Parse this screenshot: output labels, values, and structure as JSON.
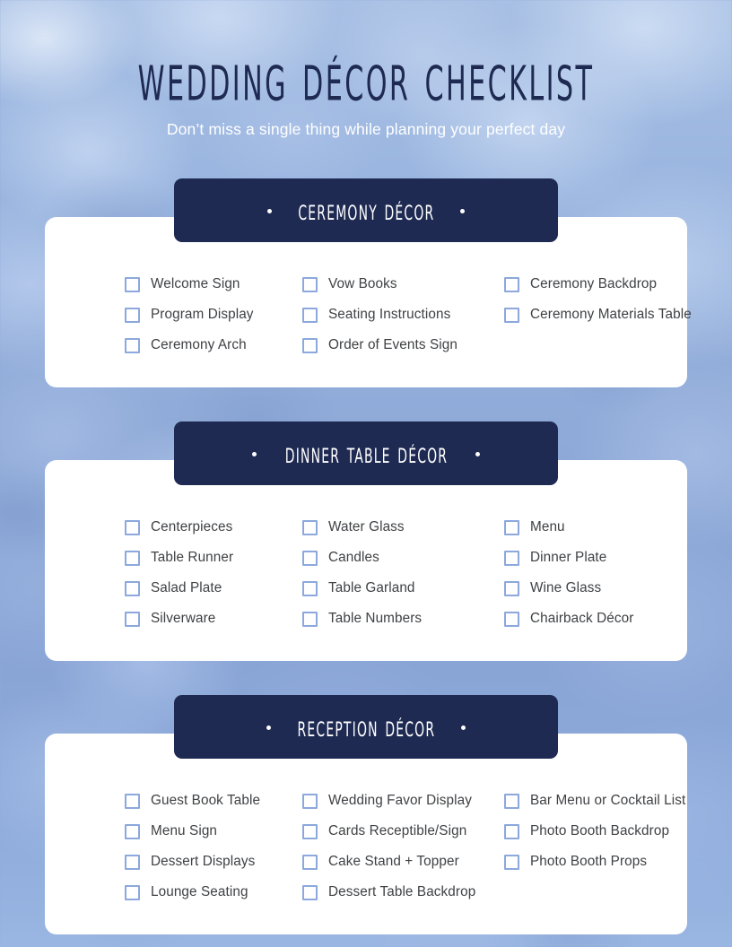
{
  "header": {
    "title": "Wedding Décor Checklist",
    "subtitle": "Don’t miss a single thing while planning your perfect day"
  },
  "colors": {
    "navy": "#1E2A52",
    "title_navy": "#1F2A52",
    "checkbox_border": "#8CA8DC",
    "label_text": "#3F4144",
    "card_bg": "#FFFFFF",
    "background_blue": "#8FAAD8"
  },
  "badge_dot": "•",
  "sections": [
    {
      "id": "ceremony",
      "title": "Ceremony Décor",
      "columns": [
        [
          "Welcome Sign",
          "Program Display",
          "Ceremony Arch"
        ],
        [
          "Vow Books",
          "Seating Instructions",
          "Order of Events Sign"
        ],
        [
          "Ceremony Backdrop",
          "Ceremony Materials Table",
          ""
        ]
      ]
    },
    {
      "id": "dinner",
      "title": "Dinner Table Décor",
      "columns": [
        [
          "Centerpieces",
          "Table Runner",
          "Salad Plate",
          "Silverware"
        ],
        [
          "Water Glass",
          "Candles",
          "Table Garland",
          "Table Numbers"
        ],
        [
          "Menu",
          "Dinner Plate",
          "Wine Glass",
          "Chairback Décor"
        ]
      ]
    },
    {
      "id": "reception",
      "title": "Reception Décor",
      "columns": [
        [
          "Guest Book Table",
          "Menu Sign",
          "Dessert Displays",
          "Lounge Seating"
        ],
        [
          "Wedding Favor Display",
          "Cards Receptible/Sign",
          "Cake Stand + Topper",
          "Dessert Table Backdrop"
        ],
        [
          "Bar Menu or Cocktail List",
          "Photo Booth Backdrop",
          "Photo Booth Props",
          ""
        ]
      ]
    }
  ]
}
